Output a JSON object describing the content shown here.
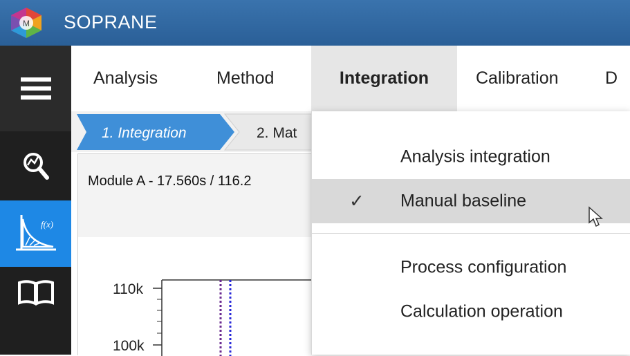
{
  "app": {
    "title": "SOPRANE"
  },
  "menubar": {
    "tabs": [
      {
        "label": "Analysis",
        "active": false
      },
      {
        "label": "Method",
        "active": false
      },
      {
        "label": "Integration",
        "active": true
      },
      {
        "label": "Calibration",
        "active": false
      },
      {
        "label": "D",
        "active": false
      }
    ]
  },
  "sidebar": {
    "items": [
      {
        "icon": "hamburger-menu-icon",
        "selected": false
      },
      {
        "icon": "analysis-search-icon",
        "selected": false
      },
      {
        "icon": "integration-fx-icon",
        "label": "f(x)",
        "selected": true
      },
      {
        "icon": "book-icon",
        "selected": false
      }
    ],
    "accent_color": "#1e88e5"
  },
  "steps": [
    {
      "label": "1. Integration",
      "active": true
    },
    {
      "label": "2. Mat",
      "active": false
    }
  ],
  "panel": {
    "module_label": "Module A - 17.560s / 116.2",
    "y_ticks": [
      "110k",
      "100k"
    ]
  },
  "dropdown": {
    "items": [
      {
        "label": "Analysis integration",
        "checked": false,
        "hover": false
      },
      {
        "label": "Manual baseline",
        "checked": true,
        "hover": true
      },
      {
        "label": "Process configuration",
        "checked": false,
        "hover": false
      },
      {
        "label": "Calculation operation",
        "checked": false,
        "hover": false
      }
    ],
    "check_glyph": "✓"
  },
  "colors": {
    "titlebar": "#2f68a3",
    "step_active": "#3f8fd8",
    "trace_purple": "#6a2a8f",
    "trace_blue": "#2a2ad8"
  }
}
